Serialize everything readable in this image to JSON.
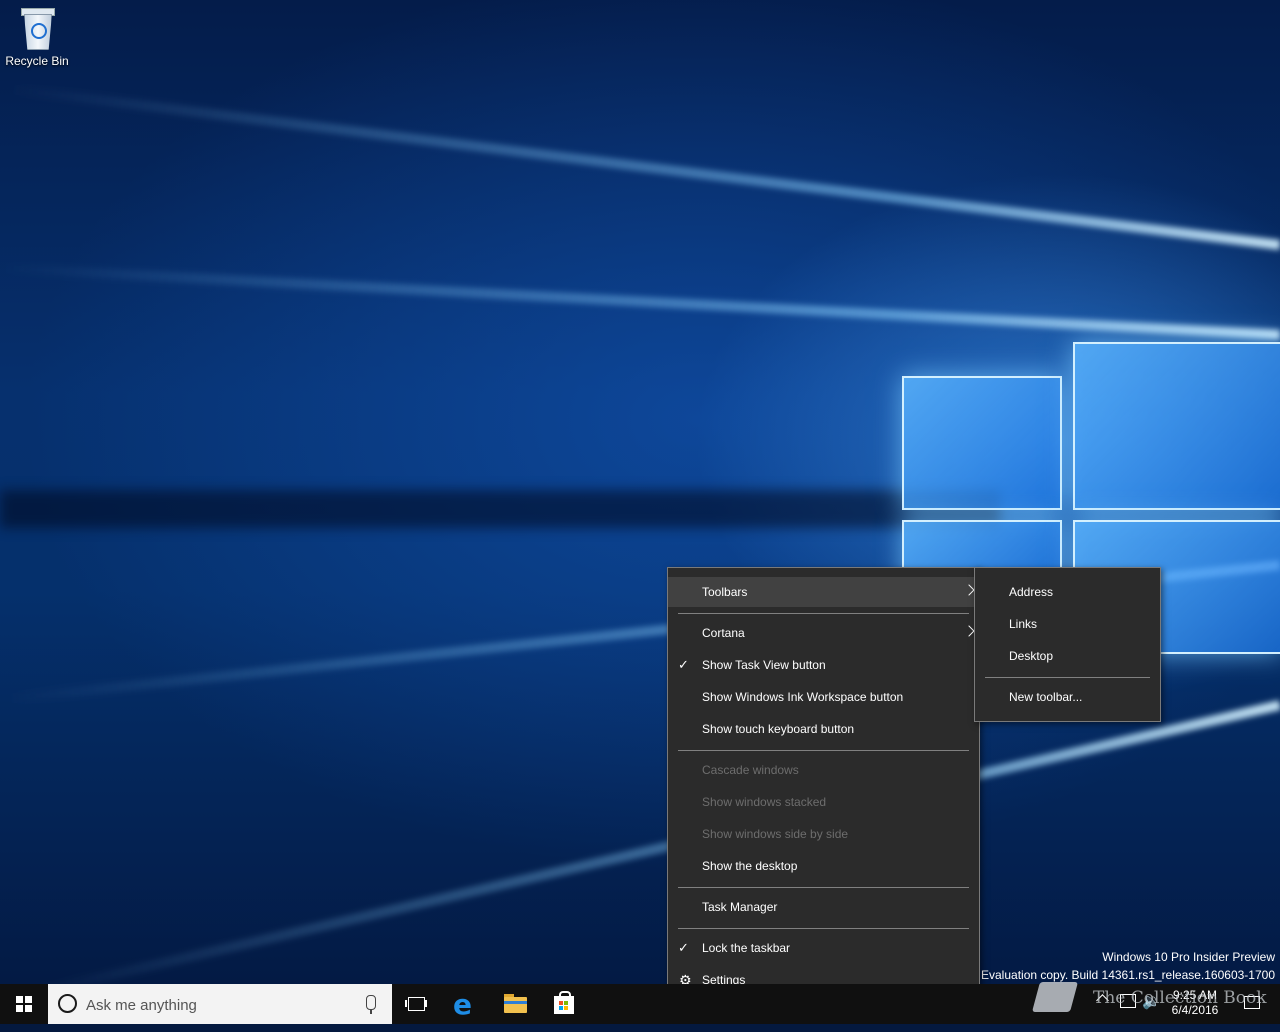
{
  "desktop": {
    "recycle_bin_label": "Recycle Bin",
    "watermark_line1": "Windows 10 Pro Insider Preview",
    "watermark_line2": "Evaluation copy. Build 14361.rs1_release.160603-1700",
    "watermark_logo_text": "The Collection Book"
  },
  "context_menu": {
    "items": {
      "toolbars": "Toolbars",
      "cortana": "Cortana",
      "show_task_view": "Show Task View button",
      "show_ink": "Show Windows Ink Workspace button",
      "show_touch_keyboard": "Show touch keyboard button",
      "cascade": "Cascade windows",
      "stacked": "Show windows stacked",
      "side_by_side": "Show windows side by side",
      "show_desktop": "Show the desktop",
      "task_manager": "Task Manager",
      "lock_taskbar": "Lock the taskbar",
      "settings": "Settings"
    },
    "checked": [
      "Show Task View button",
      "Lock the taskbar"
    ],
    "disabled": [
      "Cascade windows",
      "Show windows stacked",
      "Show windows side by side"
    ]
  },
  "toolbars_submenu": {
    "address": "Address",
    "links": "Links",
    "desktop": "Desktop",
    "new_toolbar": "New toolbar..."
  },
  "taskbar": {
    "search_placeholder": "Ask me anything",
    "clock_time": "9:25 AM",
    "clock_date": "6/4/2016",
    "pinned_icons": [
      "task-view-icon",
      "edge-icon",
      "file-explorer-icon",
      "store-icon"
    ]
  },
  "icons": {
    "check": "✓",
    "gear": "⚙",
    "volume": "🔉"
  },
  "colors": {
    "menu_bg": "#2b2b2b",
    "menu_highlight": "#414141",
    "taskbar_bg": "#101010",
    "accent_blue": "#1e8de6"
  }
}
